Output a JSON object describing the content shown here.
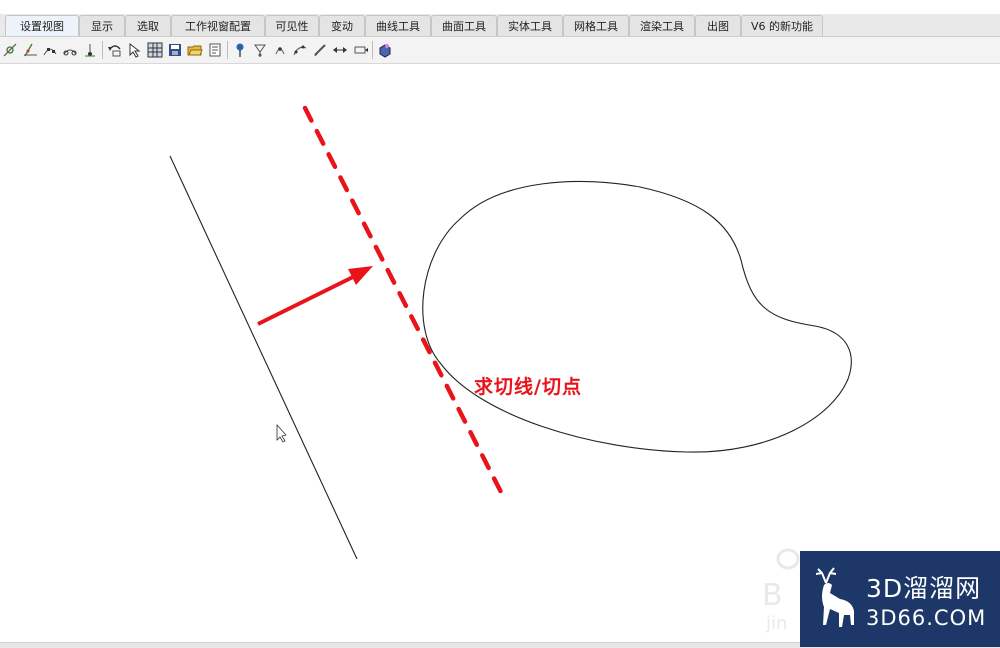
{
  "tabs": [
    {
      "label": "设置视图"
    },
    {
      "label": "显示"
    },
    {
      "label": "选取"
    },
    {
      "label": "工作视窗配置"
    },
    {
      "label": "可见性"
    },
    {
      "label": "变动"
    },
    {
      "label": "曲线工具"
    },
    {
      "label": "曲面工具"
    },
    {
      "label": "实体工具"
    },
    {
      "label": "网格工具"
    },
    {
      "label": "渲染工具"
    },
    {
      "label": "出图"
    },
    {
      "label": "V6 的新功能"
    }
  ],
  "toolbar_icons": [
    "point-tangent-icon",
    "tangent-line-icon",
    "curve-points-icon",
    "curve-handle-icon",
    "end-point-icon",
    "undo-view-icon",
    "select-arrow-icon",
    "grid-toggle-icon",
    "save-icon",
    "open-folder-icon",
    "properties-icon",
    "pin-icon",
    "lower-icon",
    "insert-icon",
    "curve-edit-icon",
    "edit-icon",
    "arrows-icon",
    "move-icon",
    "render-icon"
  ],
  "annotation": {
    "text": "求切线/切点",
    "color": "#e8141a"
  },
  "brand": {
    "title": "3D溜溜网",
    "subtitle": "3D66.COM",
    "background": "#1d3868"
  },
  "colors": {
    "accent_red": "#e8141a",
    "line": "#222222"
  }
}
